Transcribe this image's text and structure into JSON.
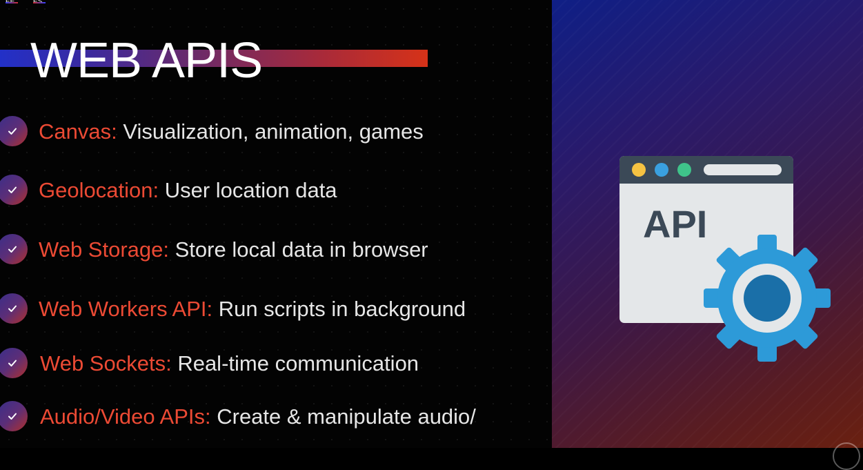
{
  "tags": [
    "FE",
    "FS"
  ],
  "title": "WEB APIS",
  "items": [
    {
      "term": "Canvas:",
      "desc": "Visualization, animation, games"
    },
    {
      "term": "Geolocation:",
      "desc": "User location data"
    },
    {
      "term": "Web Storage:",
      "desc": "Store local data in browser"
    },
    {
      "term": "Web Workers API:",
      "desc": "Run scripts in background"
    },
    {
      "term": "Web Sockets:",
      "desc": "Real-time communication"
    },
    {
      "term": "Audio/Video APIs:",
      "desc": "Create & manipulate audio/"
    }
  ],
  "illustration": {
    "label": "API",
    "dots": [
      "#f5c242",
      "#3aa0e0",
      "#3fc38a"
    ],
    "gear_color": "#2d9ad8",
    "gear_hub_color": "#1a6fa8",
    "window_bar_color": "#3b4957",
    "window_body_color": "#e4e7e9",
    "label_color": "#3b4957"
  },
  "colors": {
    "term": "#ec4a34",
    "desc": "#e6e6e6"
  }
}
